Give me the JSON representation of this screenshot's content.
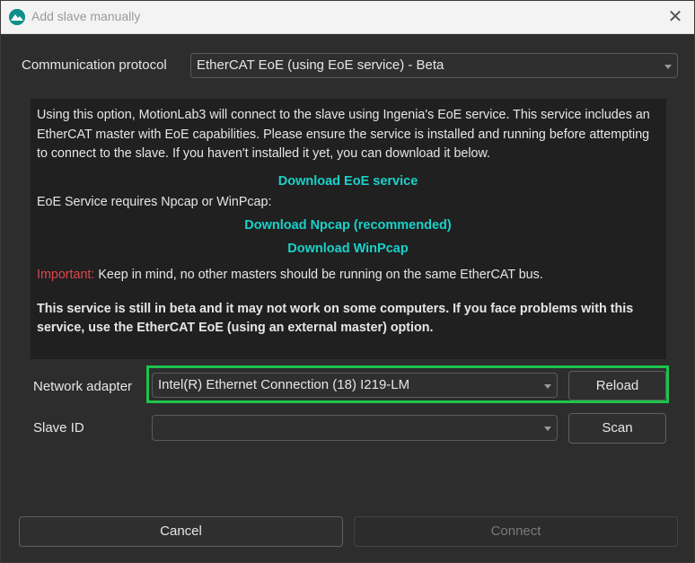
{
  "window": {
    "title": "Add slave manually",
    "close_symbol": "✕"
  },
  "protocol": {
    "label": "Communication protocol",
    "selected": "EtherCAT EoE (using EoE service) - Beta"
  },
  "info": {
    "paragraph": "Using this option, MotionLab3 will connect to the slave using Ingenia's EoE service. This service includes an EtherCAT master with EoE capabilities. Please ensure the service is installed and running before attempting to connect to the slave. If you haven't installed it yet, you can download it below.",
    "download_eoe": "Download EoE service",
    "npcap_requirement": "EoE Service requires Npcap or WinPcap:",
    "download_npcap": "Download Npcap (recommended)",
    "download_winpcap": "Download WinPcap",
    "important_label": "Important:",
    "important_text": " Keep in mind, no other masters should be running on the same EtherCAT bus.",
    "beta_warning": "This service is still in beta and it may not work on some computers. If you face problems with this service, use the EtherCAT EoE (using an external master) option."
  },
  "network_adapter": {
    "label": "Network adapter",
    "selected": "Intel(R) Ethernet Connection (18) I219-LM",
    "reload_label": "Reload"
  },
  "slave_id": {
    "label": "Slave ID",
    "selected": "",
    "scan_label": "Scan"
  },
  "footer": {
    "cancel_label": "Cancel",
    "connect_label": "Connect"
  },
  "colors": {
    "link": "#19d1c9",
    "important": "#e0454b",
    "highlight": "#1ec44b",
    "background": "#2d2d2d",
    "info_background": "#202020"
  },
  "icons": {
    "app": "motionlab-app-icon",
    "close": "close-icon",
    "dropdown": "chevron-down-icon"
  }
}
